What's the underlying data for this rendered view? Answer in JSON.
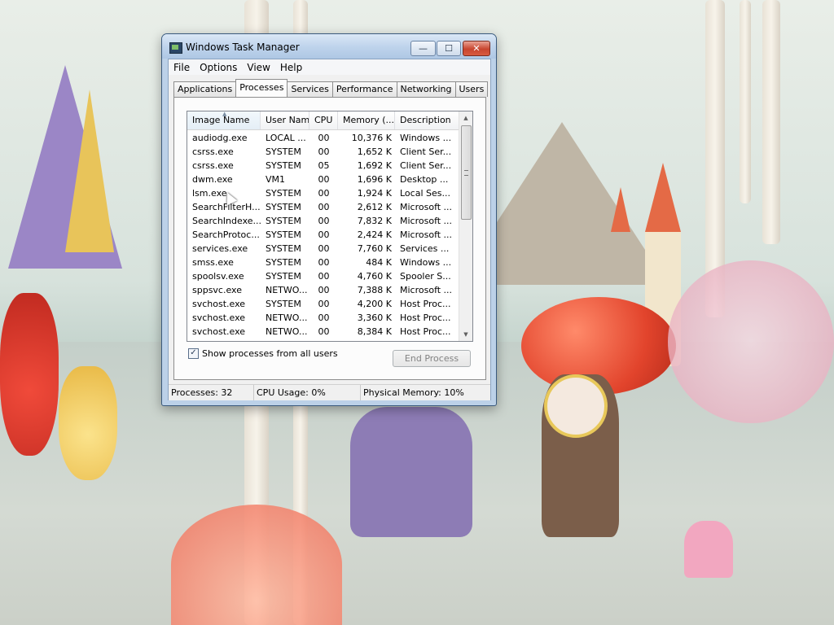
{
  "window": {
    "title": "Windows Task Manager",
    "controls": {
      "minimize": "—",
      "maximize": "☐",
      "close": "✕"
    }
  },
  "menu": [
    "File",
    "Options",
    "View",
    "Help"
  ],
  "tabs": [
    "Applications",
    "Processes",
    "Services",
    "Performance",
    "Networking",
    "Users"
  ],
  "active_tab": "Processes",
  "columns": {
    "name": "Image Name",
    "user": "User Name",
    "cpu": "CPU",
    "memory": "Memory (...",
    "description": "Description"
  },
  "processes": [
    {
      "name": "audiodg.exe",
      "user": "LOCAL ...",
      "cpu": "00",
      "memory": "10,376 K",
      "description": "Windows ..."
    },
    {
      "name": "csrss.exe",
      "user": "SYSTEM",
      "cpu": "00",
      "memory": "1,652 K",
      "description": "Client Ser..."
    },
    {
      "name": "csrss.exe",
      "user": "SYSTEM",
      "cpu": "05",
      "memory": "1,692 K",
      "description": "Client Ser..."
    },
    {
      "name": "dwm.exe",
      "user": "VM1",
      "cpu": "00",
      "memory": "1,696 K",
      "description": "Desktop ..."
    },
    {
      "name": "lsm.exe",
      "user": "SYSTEM",
      "cpu": "00",
      "memory": "1,924 K",
      "description": "Local Ses..."
    },
    {
      "name": "SearchFilterH...",
      "user": "SYSTEM",
      "cpu": "00",
      "memory": "2,612 K",
      "description": "Microsoft ..."
    },
    {
      "name": "SearchIndexe...",
      "user": "SYSTEM",
      "cpu": "00",
      "memory": "7,832 K",
      "description": "Microsoft ..."
    },
    {
      "name": "SearchProtoc...",
      "user": "SYSTEM",
      "cpu": "00",
      "memory": "2,424 K",
      "description": "Microsoft ..."
    },
    {
      "name": "services.exe",
      "user": "SYSTEM",
      "cpu": "00",
      "memory": "7,760 K",
      "description": "Services ..."
    },
    {
      "name": "smss.exe",
      "user": "SYSTEM",
      "cpu": "00",
      "memory": "484 K",
      "description": "Windows ..."
    },
    {
      "name": "spoolsv.exe",
      "user": "SYSTEM",
      "cpu": "00",
      "memory": "4,760 K",
      "description": "Spooler S..."
    },
    {
      "name": "sppsvc.exe",
      "user": "NETWO...",
      "cpu": "00",
      "memory": "7,388 K",
      "description": "Microsoft ..."
    },
    {
      "name": "svchost.exe",
      "user": "SYSTEM",
      "cpu": "00",
      "memory": "4,200 K",
      "description": "Host Proc..."
    },
    {
      "name": "svchost.exe",
      "user": "NETWO...",
      "cpu": "00",
      "memory": "3,360 K",
      "description": "Host Proc..."
    },
    {
      "name": "svchost.exe",
      "user": "NETWO...",
      "cpu": "00",
      "memory": "8,384 K",
      "description": "Host Proc..."
    }
  ],
  "show_all_users": {
    "label": "Show processes from all users",
    "checked": true
  },
  "end_process_label": "End Process",
  "status": {
    "processes": "Processes: 32",
    "cpu": "CPU Usage: 0%",
    "memory": "Physical Memory: 10%"
  },
  "icons": {
    "app": "task-manager-icon",
    "check": "✓",
    "sort": "▲",
    "scroll_up": "▲",
    "scroll_down": "▼"
  },
  "colors": {
    "title_bar": "#bfd4ec",
    "close_button": "#c8452f",
    "selected_column": "#e4eef6"
  }
}
